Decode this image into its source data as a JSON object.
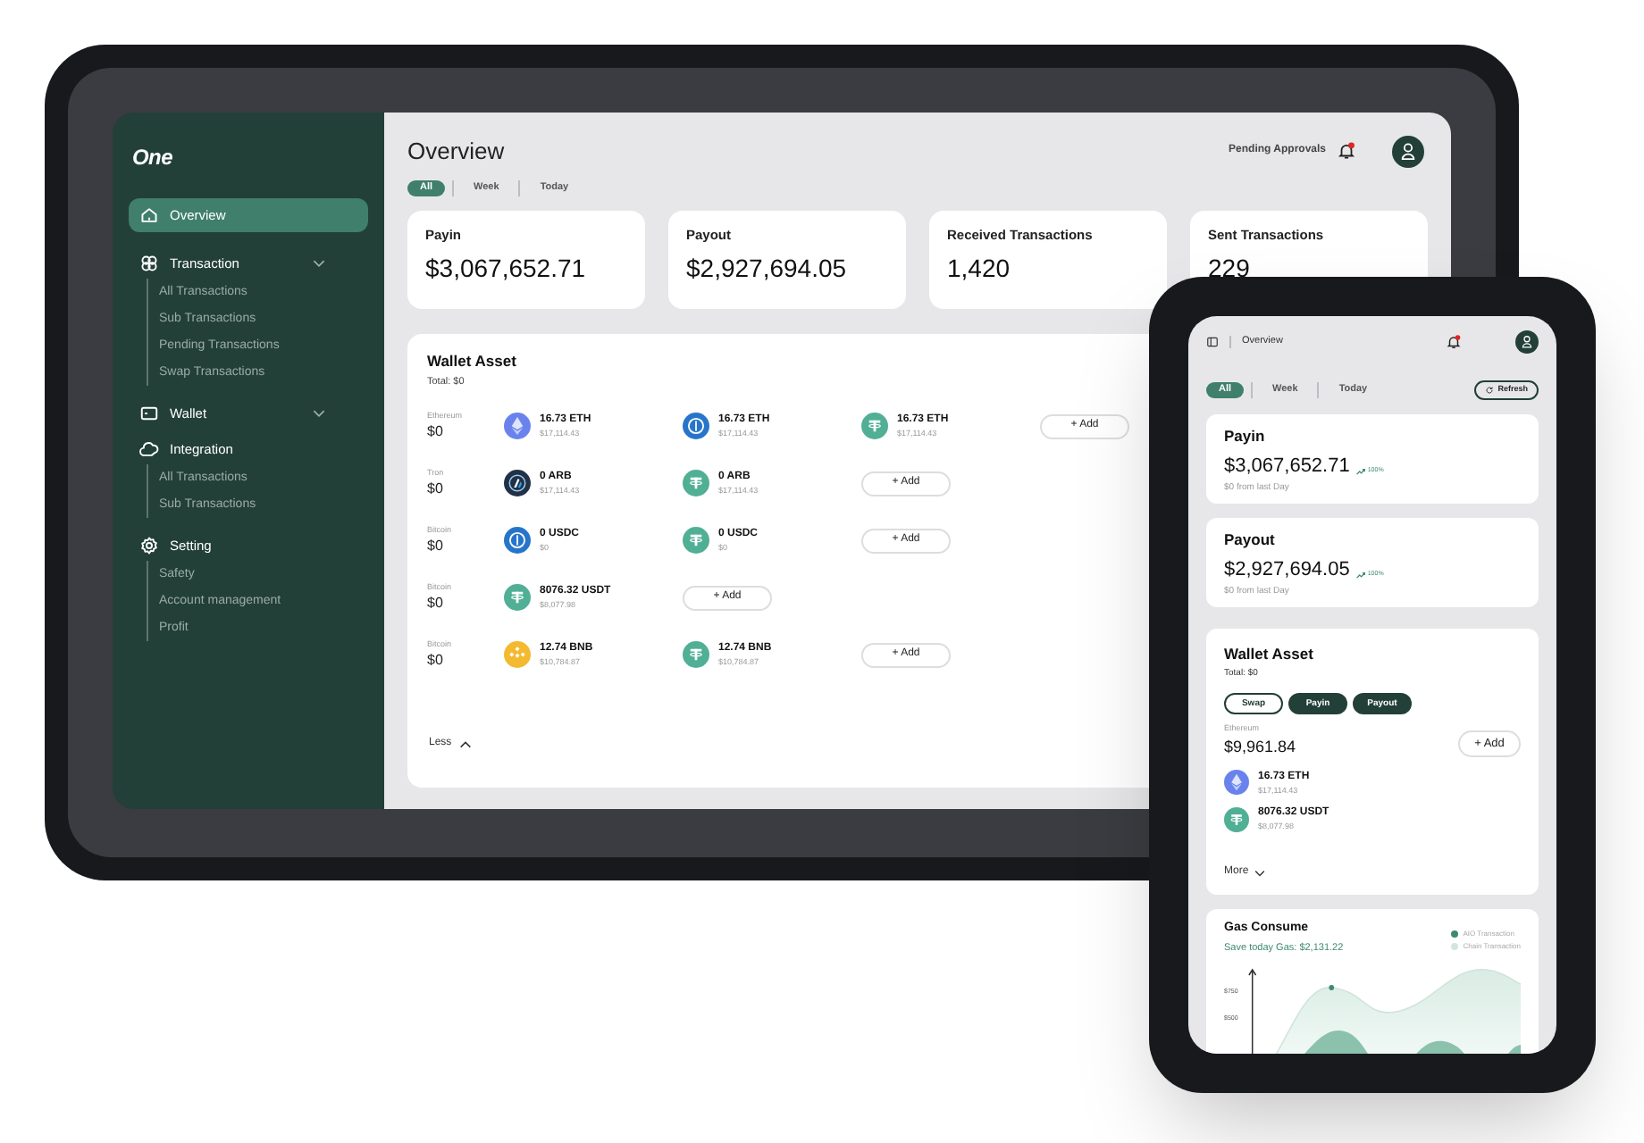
{
  "tablet": {
    "logo": "One",
    "sidebar": {
      "items": [
        {
          "label": "Overview",
          "selected": true,
          "expandable": false
        },
        {
          "label": "Transaction",
          "selected": false,
          "expandable": true,
          "children": [
            {
              "label": "All Transactions"
            },
            {
              "label": "Sub Transactions"
            },
            {
              "label": "Pending Transactions"
            },
            {
              "label": "Swap Transactions"
            }
          ]
        },
        {
          "label": "Wallet",
          "selected": false,
          "expandable": true
        },
        {
          "label": "Integration",
          "selected": false,
          "expandable": false,
          "children": [
            {
              "label": "All Transactions"
            },
            {
              "label": "Sub Transactions"
            }
          ]
        },
        {
          "label": "Setting",
          "selected": false,
          "expandable": false,
          "children": [
            {
              "label": "Safety"
            },
            {
              "label": "Account management"
            },
            {
              "label": "Profit"
            }
          ]
        }
      ]
    },
    "title": "Overview",
    "pending": "Pending Approvals",
    "filters": [
      {
        "label": "All",
        "selected": true
      },
      {
        "label": "Week",
        "selected": false
      },
      {
        "label": "Today",
        "selected": false
      }
    ],
    "stats": [
      {
        "label": "Payin",
        "value": "$3,067,652.71"
      },
      {
        "label": "Payout",
        "value": "$2,927,694.05"
      },
      {
        "label": "Received Transactions",
        "value": "1,420"
      },
      {
        "label": "Sent Transactions",
        "value": "229"
      }
    ],
    "wallet": {
      "title": "Wallet Asset",
      "total": "Total: $0",
      "rows": [
        {
          "network": "Ethereum",
          "total": "$0",
          "add": "+ Add",
          "assets": [
            {
              "kind": "eth",
              "amount": "16.73 ETH",
              "value": "$17,114.43"
            },
            {
              "kind": "usdc",
              "amount": "16.73 ETH",
              "value": "$17,114.43"
            },
            {
              "kind": "usdt",
              "amount": "16.73 ETH",
              "value": "$17,114.43"
            }
          ]
        },
        {
          "network": "Tron",
          "total": "$0",
          "add": "+ Add",
          "assets": [
            {
              "kind": "arb",
              "amount": "0 ARB",
              "value": "$17,114.43"
            },
            {
              "kind": "usdt",
              "amount": "0 ARB",
              "value": "$17,114.43"
            }
          ]
        },
        {
          "network": "Bitcoin",
          "total": "$0",
          "add": "+ Add",
          "assets": [
            {
              "kind": "usdc",
              "amount": "0 USDC",
              "value": "$0"
            },
            {
              "kind": "usdt",
              "amount": "0 USDC",
              "value": "$0"
            }
          ]
        },
        {
          "network": "Bitcoin",
          "total": "$0",
          "add": "+ Add",
          "assets": [
            {
              "kind": "usdt",
              "amount": "8076.32 USDT",
              "value": "$8,077.98"
            }
          ]
        },
        {
          "network": "Bitcoin",
          "total": "$0",
          "add": "+ Add",
          "assets": [
            {
              "kind": "bnb",
              "amount": "12.74 BNB",
              "value": "$10,784.87"
            },
            {
              "kind": "usdt",
              "amount": "12.74 BNB",
              "value": "$10,784.87"
            }
          ]
        }
      ],
      "toggle": "Less"
    }
  },
  "phone": {
    "title": "Overview",
    "filters": [
      {
        "label": "All",
        "selected": true
      },
      {
        "label": "Week",
        "selected": false
      },
      {
        "label": "Today",
        "selected": false
      }
    ],
    "refresh": "Refresh",
    "stats": [
      {
        "label": "Payin",
        "value": "$3,067,652.71",
        "change": "100%",
        "note": "$0 from last Day"
      },
      {
        "label": "Payout",
        "value": "$2,927,694.05",
        "change": "100%",
        "note": "$0 from last Day"
      }
    ],
    "wallet": {
      "title": "Wallet Asset",
      "total": "Total: $0",
      "actions": [
        {
          "label": "Swap",
          "kind": "outline"
        },
        {
          "label": "Payin",
          "kind": "solid"
        },
        {
          "label": "Payout",
          "kind": "solid"
        }
      ],
      "network": "Ethereum",
      "amount": "$9,961.84",
      "add": "+ Add",
      "assets": [
        {
          "kind": "eth",
          "amount": "16.73 ETH",
          "value": "$17,114.43"
        },
        {
          "kind": "usdt",
          "amount": "8076.32 USDT",
          "value": "$8,077.98"
        }
      ],
      "toggle": "More"
    },
    "gas": {
      "title": "Gas Consume",
      "saving": "Save today Gas: $2,131.22",
      "legend": [
        {
          "label": "AIO Transaction",
          "color": "#3f8a6e"
        },
        {
          "label": "Chain Transaction",
          "color": "#d3e6dd"
        }
      ],
      "ticks": [
        "$750",
        "$500"
      ]
    }
  }
}
